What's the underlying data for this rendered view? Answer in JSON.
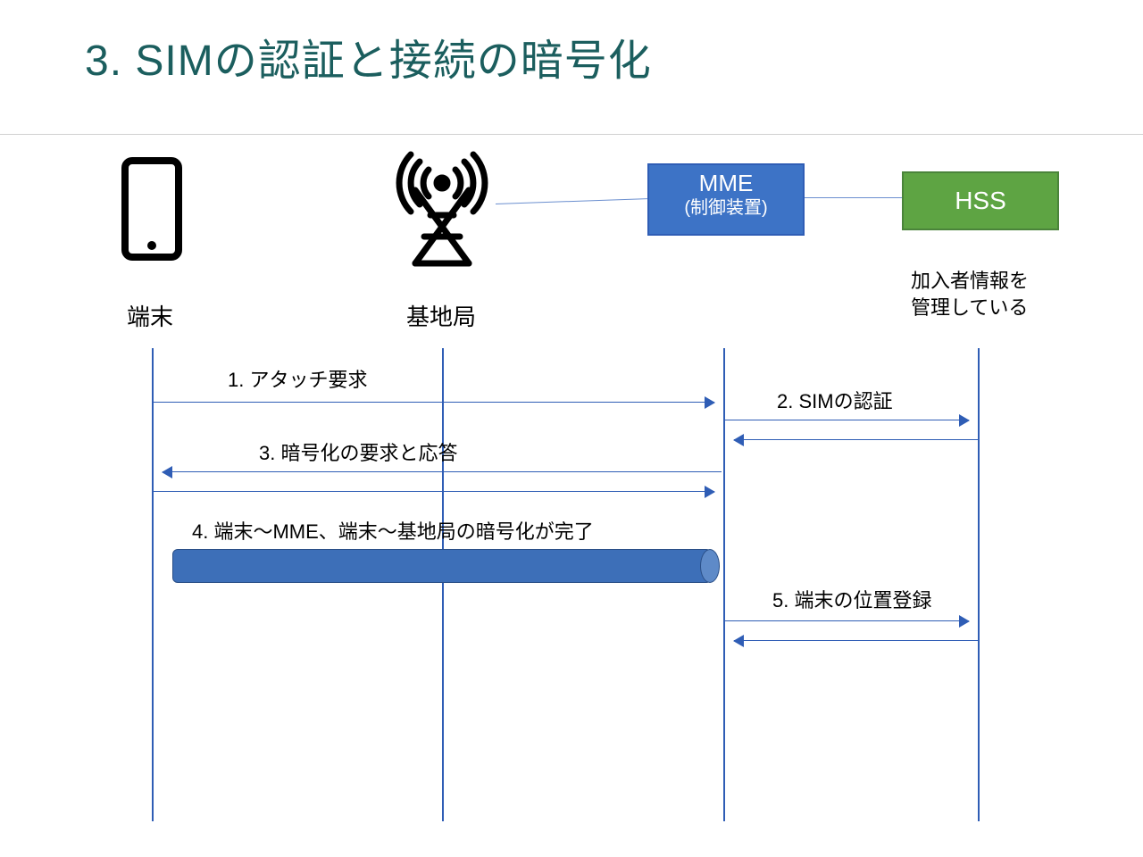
{
  "title": "3. SIMの認証と接続の暗号化",
  "nodes": {
    "ue": "端末",
    "enb": "基地局",
    "mme": "MME",
    "mme_sub": "(制御装置)",
    "hss": "HSS",
    "hss_sub": "加入者情報を\n管理している"
  },
  "messages": {
    "m1": "1. アタッチ要求",
    "m2": "2. SIMの認証",
    "m3": "3. 暗号化の要求と応答",
    "m4": "4. 端末～MME、端末～基地局の暗号化が完了",
    "m5": "5. 端末の位置登録"
  },
  "colors": {
    "title": "#1b5e5e",
    "line": "#2f5db5",
    "mme_fill": "#3d73c6",
    "hss_fill": "#5ea443",
    "pipe_fill": "#3d6fb8"
  }
}
